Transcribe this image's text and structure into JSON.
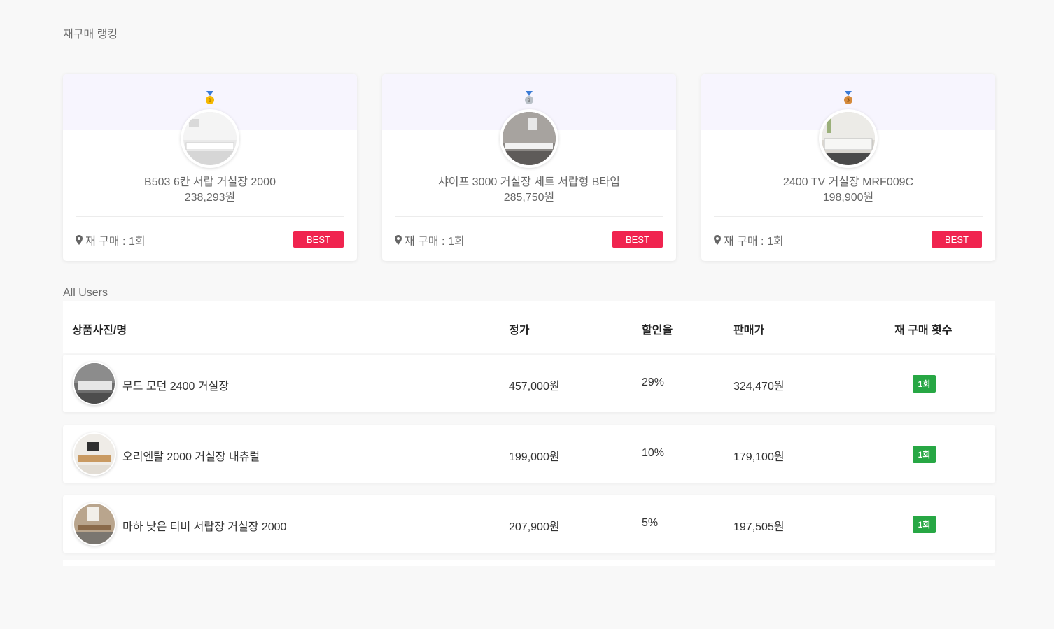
{
  "ranking": {
    "title": "재구매 랭킹",
    "cards": [
      {
        "rank": "1",
        "name": "B503 6칸 서랍 거실장 2000",
        "price": "238,293원",
        "repurchase": "재 구매 : 1회",
        "badge": "BEST",
        "medal_color": "#f5b800"
      },
      {
        "rank": "2",
        "name": "샤이프 3000 거실장 세트 서랍형 B타입",
        "price": "285,750원",
        "repurchase": "재 구매 : 1회",
        "badge": "BEST",
        "medal_color": "#b9c0c7"
      },
      {
        "rank": "3",
        "name": "2400 TV 거실장 MRF009C",
        "price": "198,900원",
        "repurchase": "재 구매 : 1회",
        "badge": "BEST",
        "medal_color": "#d58a3b"
      }
    ]
  },
  "users": {
    "title": "All Users",
    "columns": [
      "상품사진/명",
      "정가",
      "할인율",
      "판매가",
      "재 구매 횟수"
    ],
    "rows": [
      {
        "name": "무드 모던 2400 거실장",
        "list_price": "457,000원",
        "discount": "29%",
        "sale_price": "324,470원",
        "count": "1회"
      },
      {
        "name": "오리엔탈 2000 거실장 내츄럴",
        "list_price": "199,000원",
        "discount": "10%",
        "sale_price": "179,100원",
        "count": "1회"
      },
      {
        "name": "마하 낮은 티비 서랍장 거실장 2000",
        "list_price": "207,900원",
        "discount": "5%",
        "sale_price": "197,505원",
        "count": "1회"
      }
    ]
  },
  "colors": {
    "best_badge": "#f0244f",
    "count_badge": "#27a744",
    "card_band": "#f7f5fe"
  }
}
